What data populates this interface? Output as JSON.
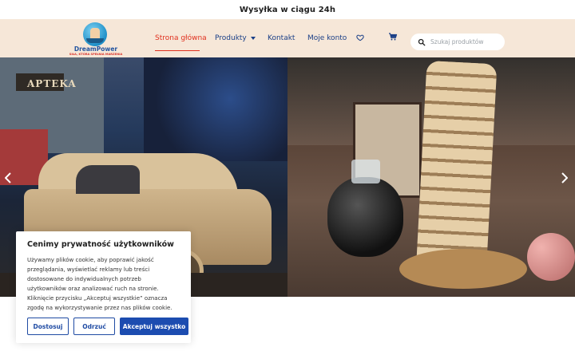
{
  "topbar": {
    "text": "Wysyłka w ciągu 24h"
  },
  "logo": {
    "name": "DreamPower",
    "tagline": "SIŁA, KTÓRA SPEŁNIA MARZENIA"
  },
  "nav": {
    "home": "Strona główna",
    "products": "Produkty",
    "contact": "Kontakt",
    "account": "Moje konto"
  },
  "search": {
    "placeholder": "Szukaj produktów"
  },
  "hero": {
    "left_sign": "APTEKA"
  },
  "cookie": {
    "title": "Cenimy prywatność użytkowników",
    "body": "Używamy plików cookie, aby poprawić jakość przeglądania, wyświetlać reklamy lub treści dostosowane do indywidualnych potrzeb użytkowników oraz analizować ruch na stronie. Kliknięcie przycisku „Akceptuj wszystkie” oznacza zgodę na wykorzystywanie przez nas plików cookie.",
    "customize": "Dostosuj",
    "reject": "Odrzuć",
    "accept_all": "Akceptuj wszystko"
  },
  "icons": {
    "heart": "heart-icon",
    "cart": "cart-icon",
    "search": "search-icon",
    "prev": "chevron-left-icon",
    "next": "chevron-right-icon"
  },
  "colors": {
    "accent": "#e0301e",
    "brand_blue": "#1c4cb0",
    "header_bg": "#f6e7d8"
  }
}
